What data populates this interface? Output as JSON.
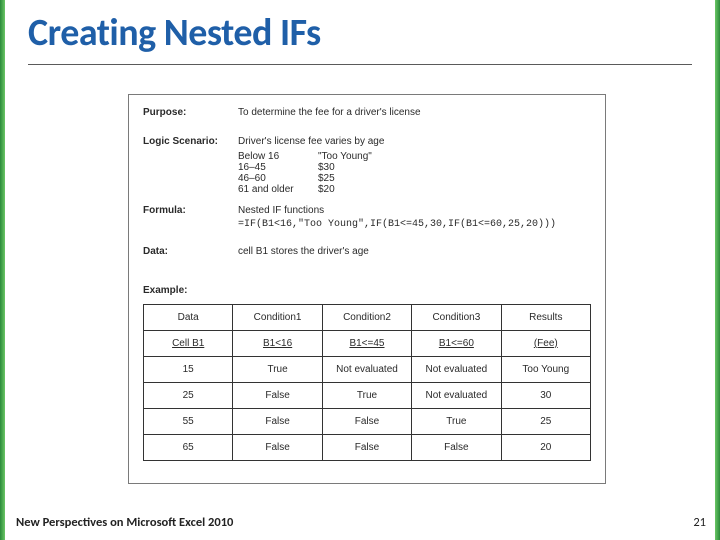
{
  "title": "Creating Nested IFs",
  "footer": "New Perspectives on Microsoft Excel 2010",
  "page_number": "21",
  "purpose": {
    "label": "Purpose:",
    "text": "To determine the fee for a driver's license"
  },
  "scenario": {
    "label": "Logic Scenario:",
    "lead": "Driver's license fee varies by age",
    "rows": [
      {
        "k": "Below 16",
        "v": "\"Too Young\""
      },
      {
        "k": "16–45",
        "v": "$30"
      },
      {
        "k": "46–60",
        "v": "$25"
      },
      {
        "k": "61 and older",
        "v": "$20"
      }
    ]
  },
  "formula": {
    "label": "Formula:",
    "line1": "Nested IF functions",
    "code": "=IF(B1<16,\"Too Young\",IF(B1<=45,30,IF(B1<=60,25,20)))"
  },
  "data_row": {
    "label": "Data:",
    "text": "cell B1 stores the driver's age"
  },
  "example_label": "Example:",
  "table": {
    "header": [
      "Data",
      "Condition1",
      "Condition2",
      "Condition3",
      "Results"
    ],
    "subheader": [
      "Cell B1",
      "B1<16",
      "B1<=45",
      "B1<=60",
      "(Fee)"
    ],
    "rows": [
      [
        "15",
        "True",
        "Not evaluated",
        "Not evaluated",
        "Too Young"
      ],
      [
        "25",
        "False",
        "True",
        "Not evaluated",
        "30"
      ],
      [
        "55",
        "False",
        "False",
        "True",
        "25"
      ],
      [
        "65",
        "False",
        "False",
        "False",
        "20"
      ]
    ]
  }
}
